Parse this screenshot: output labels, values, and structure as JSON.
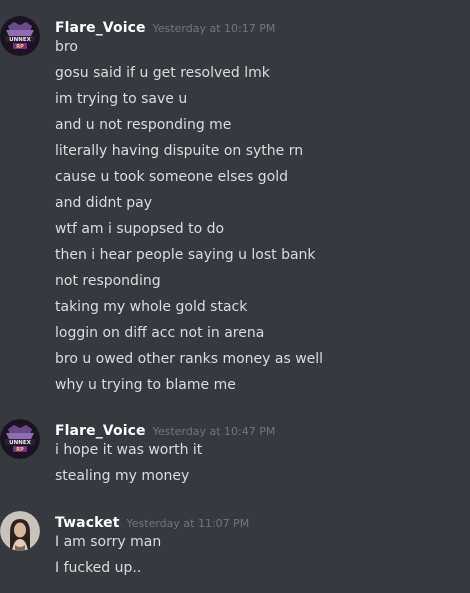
{
  "groups": [
    {
      "author": "Flare_Voice",
      "time": "Yesterday at 10:17 PM",
      "avatar_icon": "clan-emblem-avatar",
      "avatar_text": [
        "UNNE",
        "RP"
      ],
      "messages": [
        "bro",
        "gosu said if u get resolved lmk",
        "im trying to save u",
        "and u not responding me",
        "literally having dispuite on sythe rn",
        "cause u took someone elses gold",
        "and didnt pay",
        "wtf am i supopsed to do",
        "then i hear people saying u lost bank",
        "not responding",
        "taking my whole gold stack",
        "loggin on diff acc not in arena",
        "bro u owed other ranks money as well",
        "why u trying to blame me"
      ]
    },
    {
      "author": "Flare_Voice",
      "time": "Yesterday at 10:47 PM",
      "avatar_icon": "clan-emblem-avatar",
      "avatar_text": [
        "UNNE",
        "RP"
      ],
      "messages": [
        "i hope it was worth it",
        "stealing my money"
      ]
    },
    {
      "author": "Twacket",
      "time": "Yesterday at 11:07 PM",
      "avatar_icon": "person-photo-avatar",
      "messages": [
        "I am sorry man",
        "I fucked up.."
      ]
    }
  ],
  "colors": {
    "background": "#36393f",
    "username": "#ffffff",
    "timestamp": "#72767d",
    "message": "#dcddde"
  }
}
